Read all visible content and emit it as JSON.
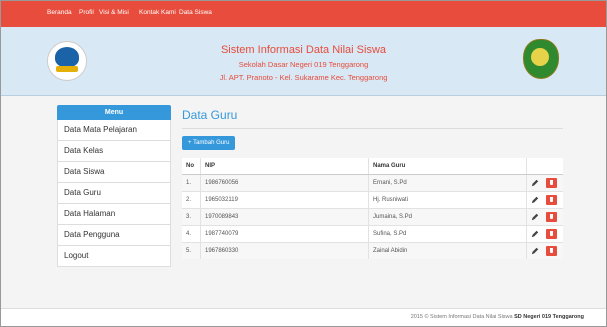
{
  "nav": [
    "Beranda",
    "Profil",
    "Visi & Misi",
    "Kontak Kami",
    "Data Siswa"
  ],
  "header": {
    "title": "Sistem Informasi Data Nilai Siswa",
    "school": "Sekolah Dasar Negeri 019 Tenggarong",
    "address": "Jl. APT. Pranoto - Kel. Sukarame Kec. Tenggarong"
  },
  "sidebar": {
    "heading": "Menu",
    "items": [
      "Data Mata Pelajaran",
      "Data Kelas",
      "Data Siswa",
      "Data Guru",
      "Data Halaman",
      "Data Pengguna",
      "Logout"
    ]
  },
  "main": {
    "heading": "Data Guru",
    "add_button": "+ Tambah Guru",
    "columns": [
      "No",
      "NIP",
      "Nama Guru",
      ""
    ],
    "rows": [
      {
        "no": "1.",
        "nip": "1986760056",
        "nama": "Ernani, S.Pd"
      },
      {
        "no": "2.",
        "nip": "1965032119",
        "nama": "Hj. Rusniwati"
      },
      {
        "no": "3.",
        "nip": "1970089843",
        "nama": "Jumaina, S.Pd"
      },
      {
        "no": "4.",
        "nip": "1987740079",
        "nama": "Sufina, S.Pd"
      },
      {
        "no": "5.",
        "nip": "1967860330",
        "nama": "Zainal Abidin"
      }
    ]
  },
  "footer": {
    "text": "2015 © Sistem Informasi Data Nilai Siswa ",
    "bold": "SD Negeri 019 Tenggarong"
  },
  "colors": {
    "nav_bg": "#e74c3c",
    "header_bg": "#d8e8f4",
    "accent": "#3498db",
    "delete": "#e74c3c"
  }
}
